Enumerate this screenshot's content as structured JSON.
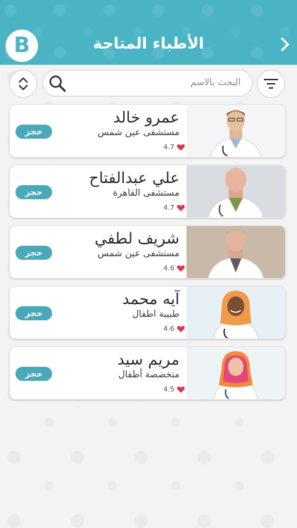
{
  "header": {
    "title": "الأطباء المتاحة",
    "logo_letter": "B",
    "back_icon": "chevron-right-icon"
  },
  "search": {
    "placeholder": "البحث بالاسم"
  },
  "colors": {
    "primary": "#4bb4c4",
    "button": "#49a9b9",
    "heart": "#e0334d"
  },
  "doctors": [
    {
      "name": "عمرو خالد",
      "hospital": "مستشفى عين شمس",
      "rating": "4.7",
      "book_label": "حجز",
      "gender": "male"
    },
    {
      "name": "علي عبدالفتاح",
      "hospital": "مستشفى القاهرة",
      "rating": "4.7",
      "book_label": "حجز",
      "gender": "male"
    },
    {
      "name": "شريف لطفي",
      "hospital": "مستشفى عين شمس",
      "rating": "4.6",
      "book_label": "حجز",
      "gender": "male"
    },
    {
      "name": "آيه محمد",
      "hospital": "طبيبة اطفال",
      "rating": "4.6",
      "book_label": "حجز",
      "gender": "female"
    },
    {
      "name": "مريم سيد",
      "hospital": "متخصصة أطفال",
      "rating": "4.5",
      "book_label": "حجز",
      "gender": "female"
    }
  ]
}
